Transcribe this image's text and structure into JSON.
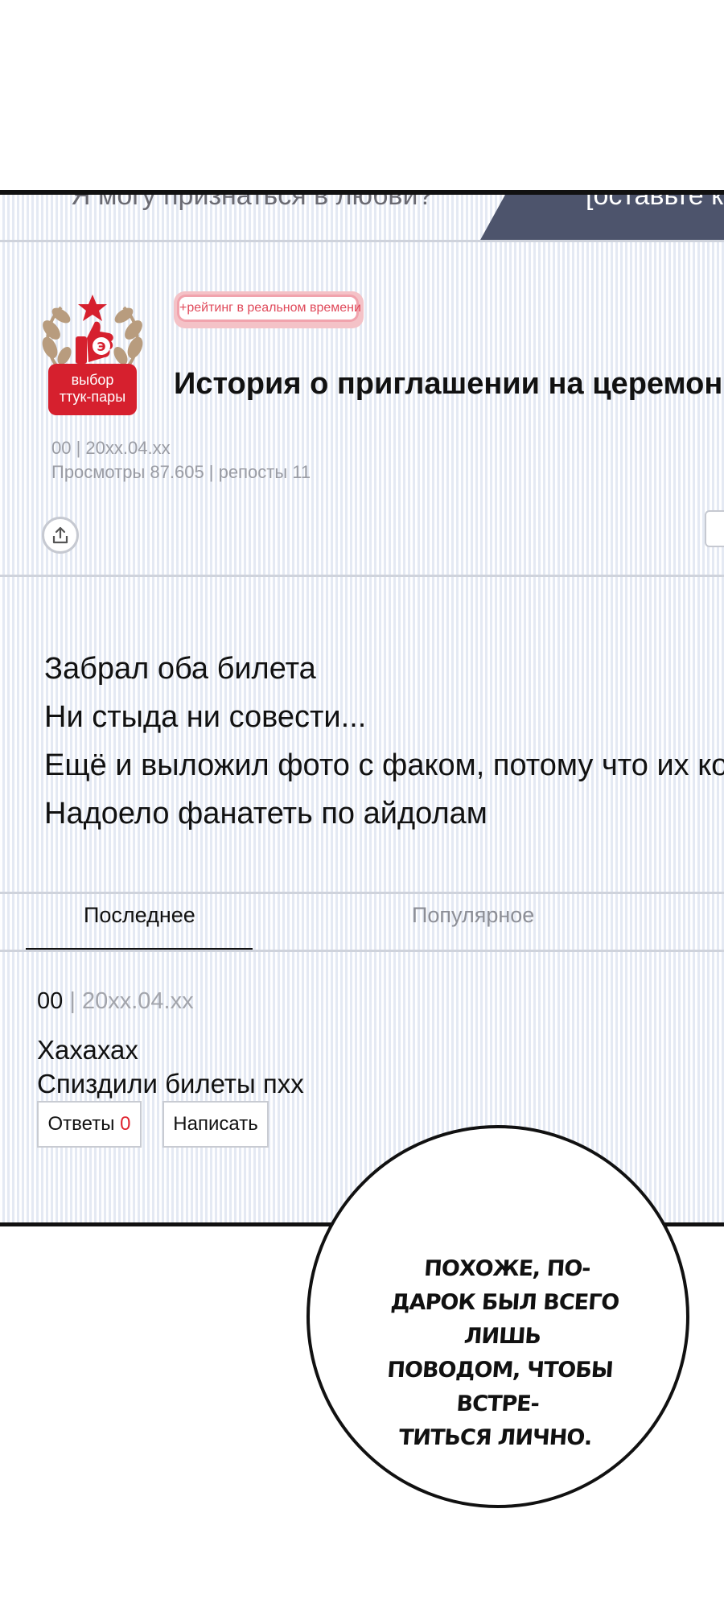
{
  "header": {
    "previous_post_title": "Я могу признаться в любви?",
    "comment_prompt": "[оставьте ко"
  },
  "post": {
    "badge_label": "выбор ттук-пары",
    "badge_line1": "выбор",
    "badge_line2": "ттук-пары",
    "realtime_tag": "+рейтинг в реальном времени",
    "title": "История о приглашении на церемонию от",
    "meta_date": "00 | 20xx.04.xx",
    "meta_stats": "Просмотры 87.605 | репосты 11",
    "body_lines": [
      "Забрал оба билета",
      "Ни стыда ни совести...",
      "Ещё и выложил фото с факом, потому что их кома",
      "Надоело фанатеть по айдолам"
    ]
  },
  "tabs": {
    "latest": "Последнее",
    "popular": "Популярное"
  },
  "comment": {
    "author": "00",
    "separator": "|",
    "date": "20xx.04.xx",
    "lines": [
      "Хахахах",
      "Спиздили билеты пхх"
    ],
    "replies_label": "Ответы",
    "replies_count": "0",
    "write_label": "Написать"
  },
  "speech_bubble": {
    "lines": [
      "ПОХОЖЕ, ПО-",
      "ДАРОК БЫЛ ВСЕГО ЛИШЬ",
      "ПОВОДОМ, ЧТОБЫ ВСТРЕ-",
      "ТИТЬСЯ ЛИЧНО."
    ]
  },
  "colors": {
    "accent_red": "#d6202e",
    "tag_pink": "#e0495a",
    "dark_tab": "#4d546c",
    "muted_text": "#9a9ca4"
  },
  "icons": {
    "badge": "laurel-thumbs-up-icon",
    "share": "share-upload-icon"
  }
}
